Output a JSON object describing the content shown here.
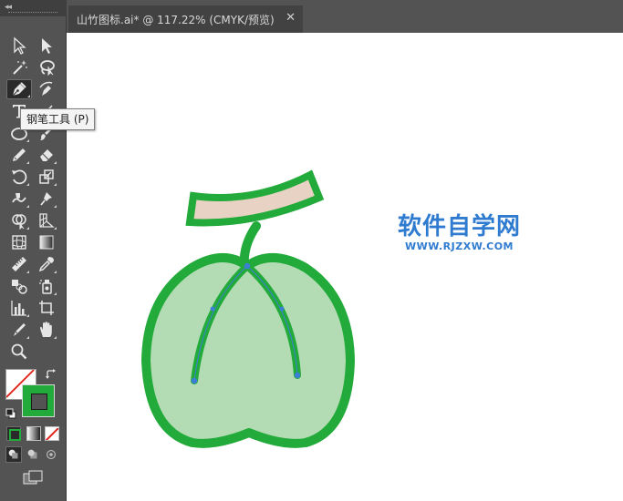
{
  "document_tab": {
    "title": "山竹图标.ai* @ 117.22% (CMYK/预览)",
    "close_glyph": "✕"
  },
  "toolbar": {
    "collapse_glyph": "◂◂",
    "tools": [
      {
        "name": "selection-tool",
        "icon": "black-arrow"
      },
      {
        "name": "direct-selection-tool",
        "icon": "white-arrow"
      },
      {
        "name": "magic-wand-tool",
        "icon": "magic-wand"
      },
      {
        "name": "lasso-tool",
        "icon": "lasso"
      },
      {
        "name": "pen-tool",
        "icon": "pen",
        "selected": true
      },
      {
        "name": "curvature-tool",
        "icon": "curvature-pen"
      },
      {
        "name": "type-tool",
        "icon": "type-T"
      },
      {
        "name": "ellipse-tool",
        "icon": "ellipse"
      },
      {
        "name": "paintbrush-tool",
        "icon": "brush"
      },
      {
        "name": "pencil-tool",
        "icon": "pencil"
      },
      {
        "name": "eraser-tool",
        "icon": "eraser"
      },
      {
        "name": "rotate-tool",
        "icon": "rotate"
      },
      {
        "name": "scale-tool",
        "icon": "scale"
      },
      {
        "name": "warp-tool",
        "icon": "warp"
      },
      {
        "name": "puppet-warp-tool",
        "icon": "pin"
      },
      {
        "name": "shape-builder-tool",
        "icon": "shape-builder"
      },
      {
        "name": "perspective-grid-tool",
        "icon": "perspective-grid"
      },
      {
        "name": "mesh-tool",
        "icon": "mesh"
      },
      {
        "name": "gradient-tool",
        "icon": "gradient"
      },
      {
        "name": "measure-tool",
        "icon": "ruler"
      },
      {
        "name": "eyedropper-tool",
        "icon": "eyedropper"
      },
      {
        "name": "blend-tool",
        "icon": "blend"
      },
      {
        "name": "symbol-sprayer-tool",
        "icon": "symbol-sprayer"
      },
      {
        "name": "column-graph-tool",
        "icon": "bar-graph"
      },
      {
        "name": "artboard-tool",
        "icon": "artboard"
      },
      {
        "name": "slice-tool",
        "icon": "slice"
      },
      {
        "name": "hand-tool",
        "icon": "hand"
      },
      {
        "name": "zoom-tool",
        "icon": "magnifier"
      }
    ]
  },
  "tooltip": {
    "text": "钢笔工具 (P)"
  },
  "colors": {
    "fill": "none",
    "stroke": "#22aa3a",
    "fruit_fill": "#b4dcb4",
    "fruit_stroke": "#22aa3a",
    "stem_fill": "#e8d2c4",
    "anchor": "#3d7fd6",
    "watermark": "#2f7bd0",
    "toolbar_bg": "#535353"
  },
  "watermark": {
    "main": "软件自学网",
    "sub": "WWW.RJZXW.COM"
  }
}
